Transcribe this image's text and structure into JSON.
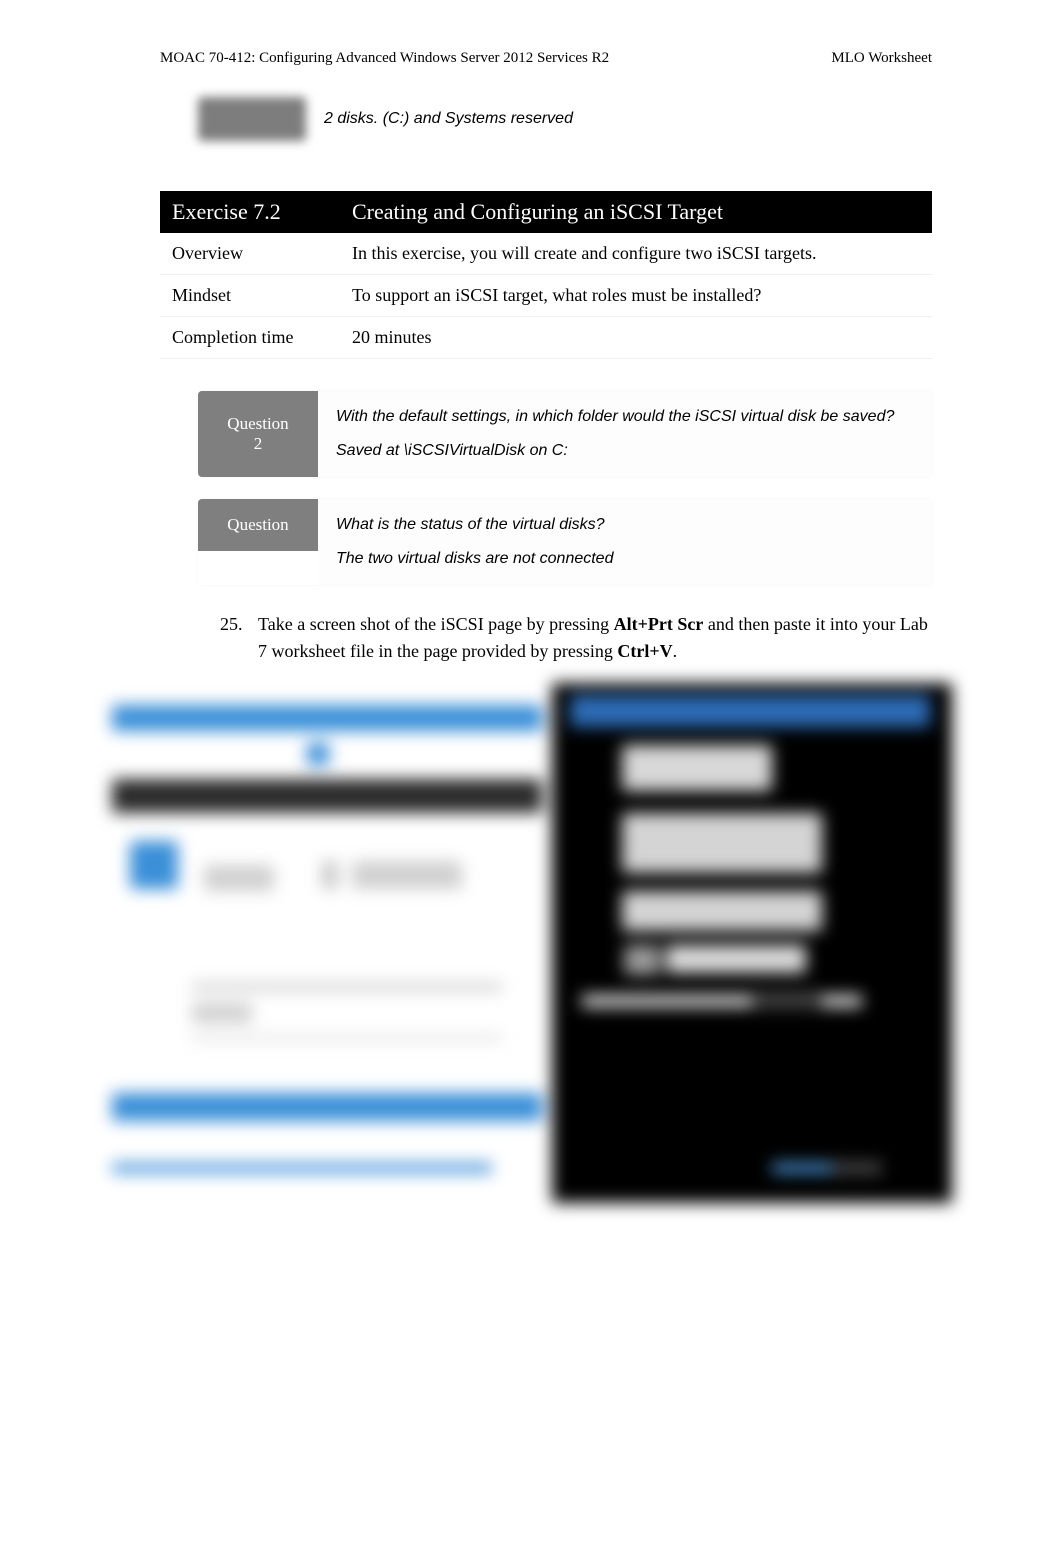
{
  "header": {
    "left": "MOAC 70-412: Configuring Advanced Windows Server 2012 Services R2",
    "right": "MLO Worksheet"
  },
  "top_answer": "2 disks. (C:) and Systems reserved",
  "exercise": {
    "number": "Exercise 7.2",
    "title": "Creating and Configuring an iSCSI Target",
    "overview_label": "Overview",
    "overview_text": "In this exercise, you will create and configure two iSCSI targets.",
    "mindset_label": "Mindset",
    "mindset_text": "To support an iSCSI target, what roles must be installed?",
    "completion_label": "Completion time",
    "completion_text": "20 minutes"
  },
  "questions": {
    "q2_label": "Question",
    "q2_num": "2",
    "q2_prompt": "With the default settings, in which folder would the iSCSI virtual disk be saved?",
    "q2_answer": "Saved at \\iSCSIVirtualDisk on C:",
    "q3_label": "Question",
    "q3_prompt": "What is the status of the virtual disks?",
    "q3_answer": "The two virtual disks are not connected"
  },
  "step": {
    "num": "25.",
    "prefix": "Take a screen shot of the iSCSI page by pressing ",
    "key1": "Alt+Prt Scr",
    "mid": " and then paste it into your Lab 7 worksheet file in the page provided by pressing ",
    "key2": "Ctrl+V",
    "suffix": "."
  }
}
